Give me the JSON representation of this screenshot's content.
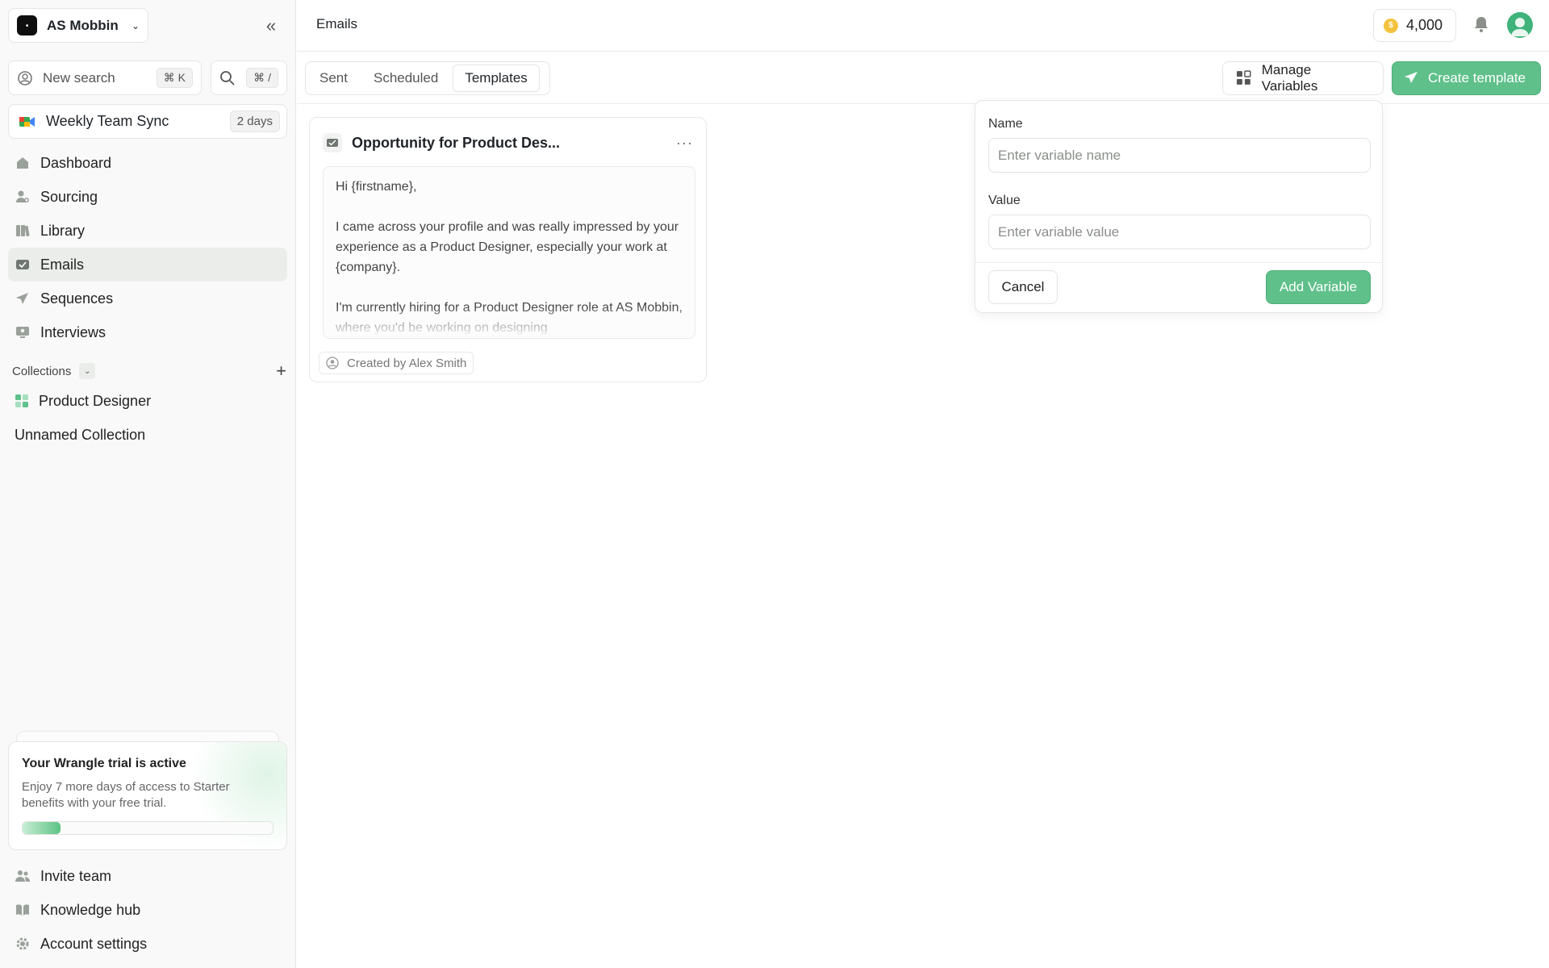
{
  "workspace": {
    "name": "AS Mobbin",
    "logo_icon": "workspace-logo-icon"
  },
  "search": {
    "label": "New search",
    "shortcut": "⌘ K",
    "quick_shortcut": "⌘ /"
  },
  "meeting": {
    "label": "Weekly Team Sync",
    "badge": "2 days"
  },
  "nav": {
    "items": [
      {
        "label": "Dashboard",
        "icon": "dashboard-icon"
      },
      {
        "label": "Sourcing",
        "icon": "sourcing-icon"
      },
      {
        "label": "Library",
        "icon": "library-icon"
      },
      {
        "label": "Emails",
        "icon": "emails-icon",
        "active": true
      },
      {
        "label": "Sequences",
        "icon": "sequences-icon"
      },
      {
        "label": "Interviews",
        "icon": "interviews-icon"
      }
    ]
  },
  "collections": {
    "heading": "Collections",
    "items": [
      {
        "label": "Product Designer",
        "icon": "collection-grid-icon"
      },
      {
        "label": "Unnamed Collection"
      }
    ]
  },
  "trial": {
    "title": "Your Wrangle trial is active",
    "text": "Enjoy 7 more days of access to Starter benefits with your free trial.",
    "progress": 0.15
  },
  "footer_nav": {
    "items": [
      {
        "label": "Invite team",
        "icon": "users-icon"
      },
      {
        "label": "Knowledge hub",
        "icon": "book-icon"
      },
      {
        "label": "Account settings",
        "icon": "gear-icon"
      }
    ]
  },
  "header": {
    "title": "Emails",
    "credits": "4,000"
  },
  "tabs": [
    {
      "label": "Sent"
    },
    {
      "label": "Scheduled"
    },
    {
      "label": "Templates",
      "active": true
    }
  ],
  "actions": {
    "manage_variables": "Manage Variables",
    "create_template": "Create template"
  },
  "template_card": {
    "title": "Opportunity for Product Des...",
    "body": [
      "Hi {firstname},",
      "I came across your profile and was really impressed by your experience as a Product Designer, especially your work at {company}.",
      "I'm currently hiring for a Product Designer role at AS Mobbin, where you'd be working on designing"
    ],
    "author": "Created by Alex Smith"
  },
  "variable_form": {
    "name_label": "Name",
    "name_placeholder": "Enter variable name",
    "value_label": "Value",
    "value_placeholder": "Enter variable value",
    "cancel": "Cancel",
    "submit": "Add Variable"
  },
  "colors": {
    "accent": "#5fc08a",
    "sidebar_bg": "#f8f9f8",
    "coin": "#f3c33f"
  }
}
